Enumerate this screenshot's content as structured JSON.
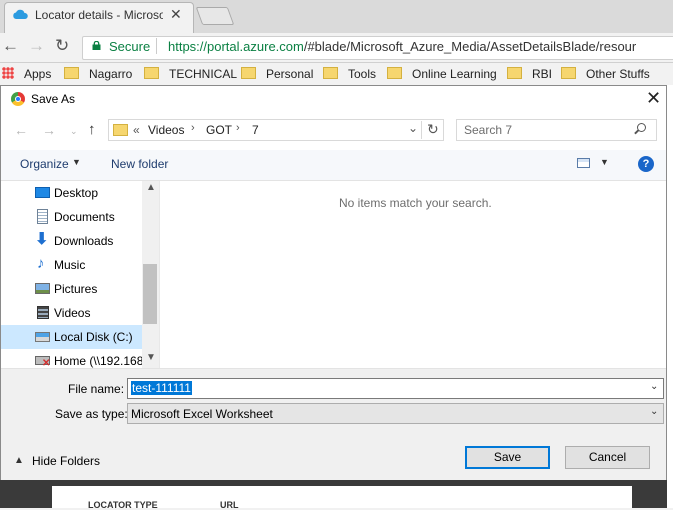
{
  "browser": {
    "tab_title": "Locator details - Microso",
    "tab_close": "✕",
    "secure_label": "Secure",
    "url_host": "https://portal.azure.com",
    "url_path": "/#blade/Microsoft_Azure_Media/AssetDetailsBlade/resour",
    "bookmarks": [
      "Apps",
      "Nagarro",
      "TECHNICAL",
      "Personal",
      "Tools",
      "Online Learning",
      "RBI",
      "Other Stuffs"
    ]
  },
  "background_page": {
    "col1": "LOCATOR TYPE",
    "col2": "URL"
  },
  "dialog": {
    "title": "Save As",
    "path_prefix": "«",
    "breadcrumbs": [
      "Videos",
      "GOT",
      "7"
    ],
    "search_placeholder": "Search 7",
    "organize_label": "Organize",
    "new_folder_label": "New folder",
    "help_label": "?",
    "nav_items": [
      {
        "label": "Desktop",
        "icon": "desktop-icon"
      },
      {
        "label": "Documents",
        "icon": "documents-icon"
      },
      {
        "label": "Downloads",
        "icon": "downloads-icon"
      },
      {
        "label": "Music",
        "icon": "music-icon"
      },
      {
        "label": "Pictures",
        "icon": "pictures-icon"
      },
      {
        "label": "Videos",
        "icon": "videos-icon"
      },
      {
        "label": "Local Disk (C:)",
        "icon": "local-disk-icon",
        "selected": true
      },
      {
        "label": "Home (\\\\192.168",
        "icon": "network-drive-icon"
      }
    ],
    "empty_message": "No items match your search.",
    "file_name_label": "File name:",
    "file_name_value": "test-111111",
    "save_type_label": "Save as type:",
    "save_type_value": "Microsoft Excel Worksheet",
    "hide_folders_label": "Hide Folders",
    "save_button": "Save",
    "cancel_button": "Cancel"
  },
  "colors": {
    "secure_green": "#0b8043",
    "selection_blue": "#0078d7",
    "nav_selected": "#cce8ff",
    "help_blue": "#1a66c9"
  }
}
